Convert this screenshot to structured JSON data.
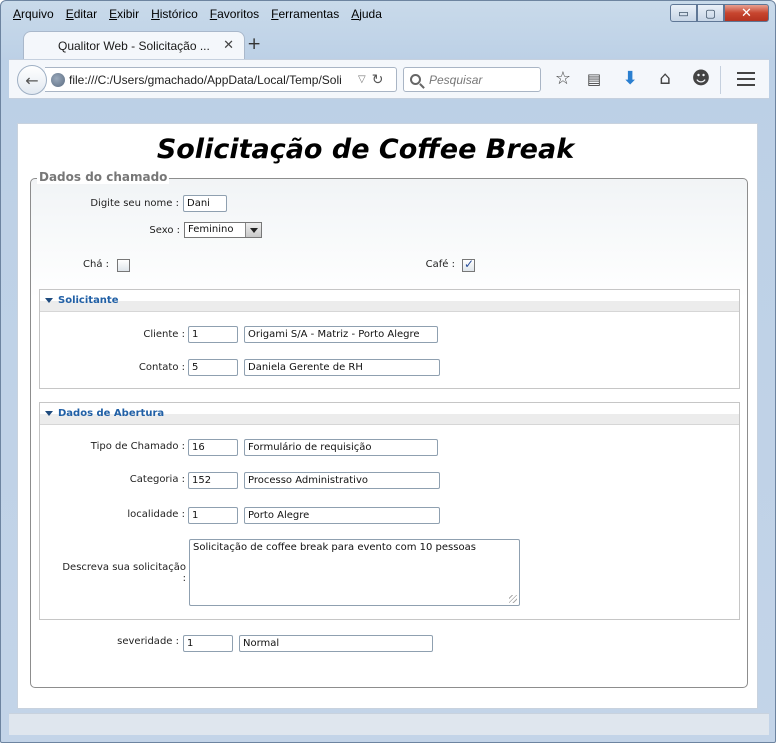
{
  "menu": [
    {
      "ul": "A",
      "rest": "rquivo"
    },
    {
      "ul": "E",
      "rest": "ditar"
    },
    {
      "ul": "E",
      "rest": "xibir"
    },
    {
      "ul": "H",
      "rest": "istórico"
    },
    {
      "ul": "F",
      "rest": "avoritos"
    },
    {
      "ul": "F",
      "rest": "erramentas"
    },
    {
      "ul": "A",
      "rest": "juda"
    }
  ],
  "window_controls": {
    "minimize": "▭",
    "maximize": "▢",
    "close": "✕"
  },
  "tab": {
    "title": "Qualitor Web - Solicitação ...",
    "close": "✕",
    "new": "+"
  },
  "nav": {
    "url": "file:///C:/Users/gmachado/AppData/Local/Temp/Soli",
    "search_placeholder": "Pesquisar",
    "icons": [
      "back-arrow-icon",
      "globe-icon",
      "reload-icon",
      "search-icon",
      "bookmark-star-icon",
      "reading-list-icon",
      "download-icon",
      "home-icon",
      "smiley-icon",
      "menu-icon"
    ]
  },
  "page": {
    "title": "Solicitação de Coffee Break",
    "fieldset_legend": "Dados do chamado",
    "nome": {
      "label": "Digite seu nome :",
      "value": "Dani"
    },
    "sexo": {
      "label": "Sexo :",
      "value": "Feminino"
    },
    "cha": {
      "label": "Chá :",
      "checked": false
    },
    "cafe": {
      "label": "Café :",
      "checked": true
    },
    "solicitante": {
      "title": "Solicitante",
      "cliente": {
        "label": "Cliente :",
        "code": "1",
        "name": "Origami S/A - Matriz - Porto Alegre"
      },
      "contato": {
        "label": "Contato :",
        "code": "5",
        "name": "Daniela Gerente de RH"
      }
    },
    "abertura": {
      "title": "Dados de Abertura",
      "tipo": {
        "label": "Tipo de Chamado :",
        "code": "16",
        "name": "Formulário de requisição"
      },
      "categoria": {
        "label": "Categoria :",
        "code": "152",
        "name": "Processo Administrativo"
      },
      "localidade": {
        "label": "localidade :",
        "code": "1",
        "name": "Porto Alegre"
      },
      "descreva": {
        "label_line1": "Descreva sua solicitação",
        "label_line2": ":",
        "value": "Solicitação de coffee break para evento com 10 pessoas"
      }
    },
    "severidade": {
      "label": "severidade :",
      "code": "1",
      "name": "Normal"
    }
  }
}
